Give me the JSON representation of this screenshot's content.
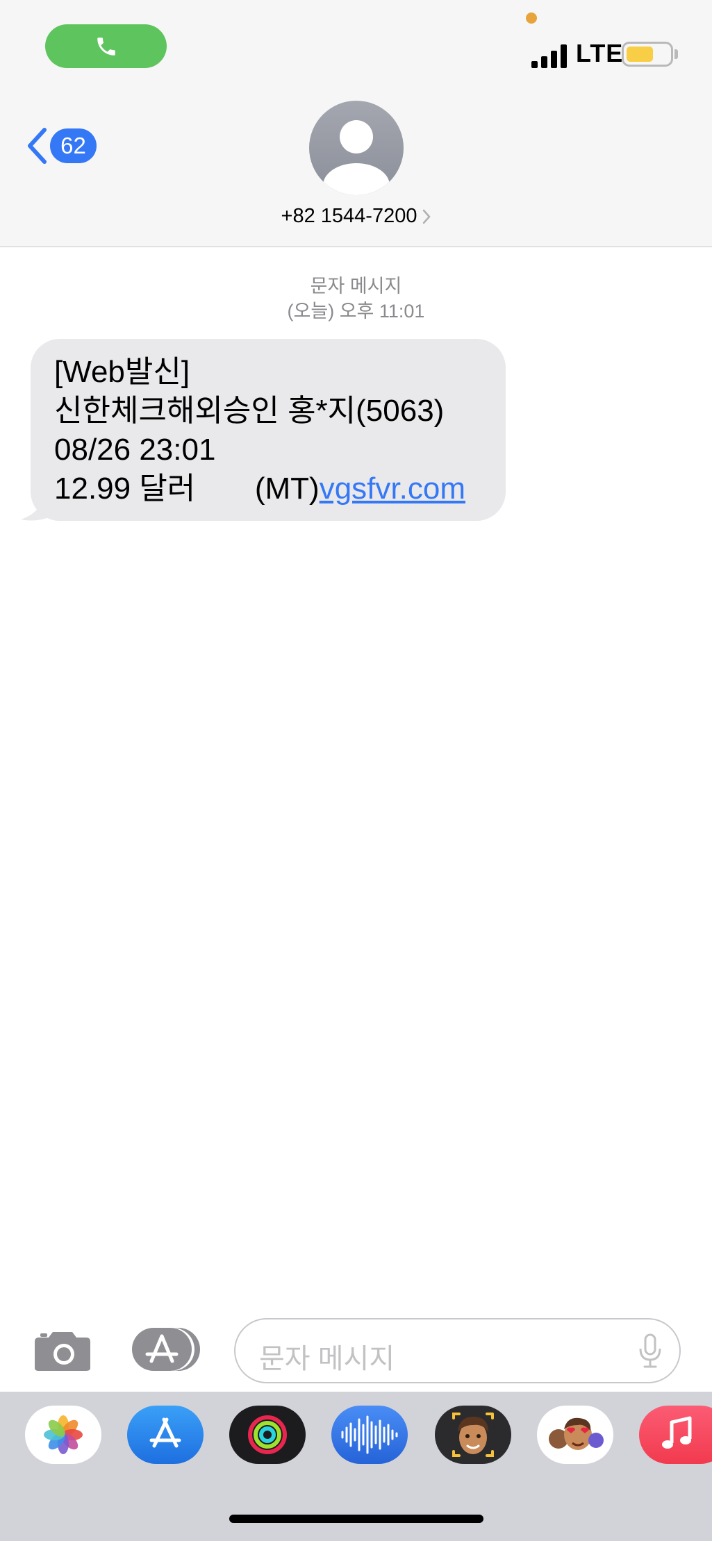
{
  "status_bar": {
    "network": "LTE",
    "battery_color": "#f7ce46",
    "call_pill_color": "#5ec45e",
    "icons": [
      "phone-icon",
      "signal-bars-icon",
      "battery-icon"
    ]
  },
  "header": {
    "back_count": "62",
    "contact_number": "+82 1544-7200",
    "accent": "#3478f6"
  },
  "conversation": {
    "service_label": "문자 메시지",
    "timestamp": "(오늘) 오후 11:01",
    "message": {
      "line1": "[Web발신]",
      "line2": "신한체크해외승인 홍*지(5063)",
      "line3": "08/26 23:01",
      "line4_text": "12.99 달러       (MT)",
      "line4_link": "vgsfvr.com"
    }
  },
  "composer": {
    "placeholder": "문자 메시지"
  },
  "app_tray": {
    "apps": [
      "photos",
      "app-store",
      "activity",
      "audio-message",
      "memoji",
      "memoji-stickers",
      "music"
    ]
  }
}
